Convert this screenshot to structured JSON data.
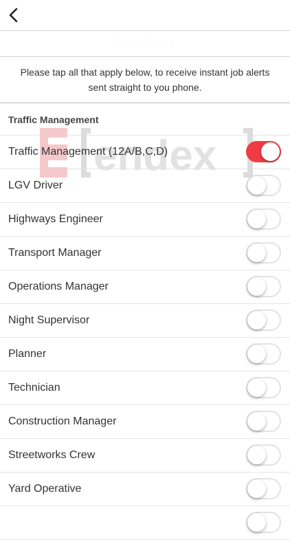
{
  "header": {
    "subtitle": "Job Alerts"
  },
  "intro": {
    "text": "Please tap all that apply below, to receive instant job alerts sent straight to you phone."
  },
  "section": {
    "title": "Traffic Management"
  },
  "watermark": {
    "text": "E[endex]"
  },
  "items": [
    {
      "label": "Traffic Management (12A/B,C,D)",
      "on": true
    },
    {
      "label": "LGV Driver",
      "on": false
    },
    {
      "label": "Highways Engineer",
      "on": false
    },
    {
      "label": "Transport Manager",
      "on": false
    },
    {
      "label": "Operations Manager",
      "on": false
    },
    {
      "label": "Night Supervisor",
      "on": false
    },
    {
      "label": "Planner",
      "on": false
    },
    {
      "label": "Technician",
      "on": false
    },
    {
      "label": "Construction Manager",
      "on": false
    },
    {
      "label": "Streetworks Crew",
      "on": false
    },
    {
      "label": "Yard Operative",
      "on": false
    },
    {
      "label": "",
      "on": false
    }
  ],
  "colors": {
    "accent": "#ef3c44",
    "toggle_off_border": "#e3e3e3",
    "divider": "#e6e6e6"
  }
}
